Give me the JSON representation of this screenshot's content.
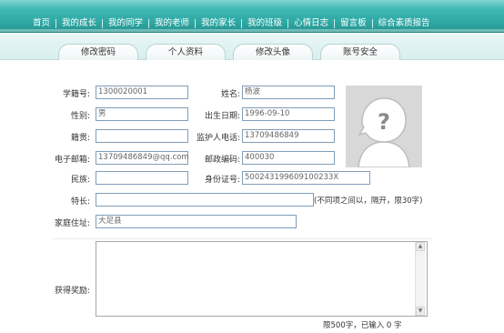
{
  "nav": {
    "items": [
      "首页",
      "我的成长",
      "我的同学",
      "我的老师",
      "我的家长",
      "我的班级",
      "心情日志",
      "留言板",
      "综合素质报告"
    ]
  },
  "tabs": [
    "修改密码",
    "个人资料",
    "修改头像",
    "账号安全"
  ],
  "form": {
    "student_id_label": "学籍号:",
    "student_id_value": "1300020001",
    "name_label": "姓名:",
    "name_value": "杨波",
    "gender_label": "性别:",
    "gender_value": "男",
    "birth_label": "出生日期:",
    "birth_value": "1996-09-10",
    "native_label": "籍贯:",
    "native_value": "",
    "guardian_phone_label": "监护人电话:",
    "guardian_phone_value": "13709486849",
    "email_label": "电子邮箱:",
    "email_value": "13709486849@qq.com",
    "postcode_label": "邮政编码:",
    "postcode_value": "400030",
    "ethnicity_label": "民族:",
    "ethnicity_value": "",
    "id_label": "身份证号:",
    "id_value": "500243199609100233X",
    "specialty_label": "特长:",
    "specialty_value": "",
    "specialty_hint": "(不同项之间以，隔开，限30字)",
    "address_label": "家庭住址:",
    "address_value": "大足县",
    "awards_label": "获得奖励:",
    "awards_value": "",
    "awards_counter": "限500字，已输入 0 字"
  },
  "colors": {
    "nav_bar": "#2ea8a4",
    "tab_strip": "#dff0f0",
    "input_border": "#7f9db9"
  },
  "icons": {
    "avatar": "avatar-placeholder-question-icon"
  }
}
